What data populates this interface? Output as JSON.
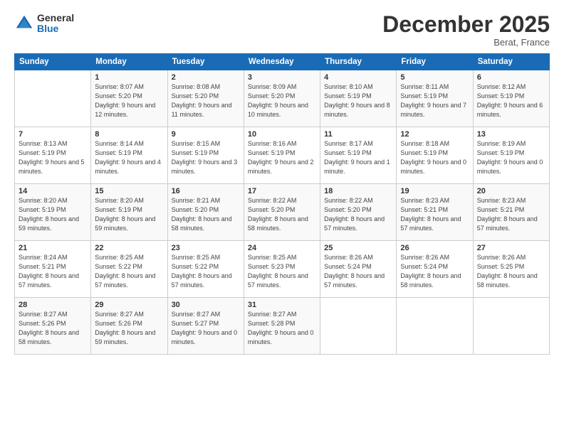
{
  "logo": {
    "general": "General",
    "blue": "Blue"
  },
  "header": {
    "title": "December 2025",
    "location": "Berat, France"
  },
  "days_of_week": [
    "Sunday",
    "Monday",
    "Tuesday",
    "Wednesday",
    "Thursday",
    "Friday",
    "Saturday"
  ],
  "weeks": [
    [
      {
        "day": "",
        "info": ""
      },
      {
        "day": "1",
        "info": "Sunrise: 8:07 AM\nSunset: 5:20 PM\nDaylight: 9 hours\nand 12 minutes."
      },
      {
        "day": "2",
        "info": "Sunrise: 8:08 AM\nSunset: 5:20 PM\nDaylight: 9 hours\nand 11 minutes."
      },
      {
        "day": "3",
        "info": "Sunrise: 8:09 AM\nSunset: 5:20 PM\nDaylight: 9 hours\nand 10 minutes."
      },
      {
        "day": "4",
        "info": "Sunrise: 8:10 AM\nSunset: 5:19 PM\nDaylight: 9 hours\nand 8 minutes."
      },
      {
        "day": "5",
        "info": "Sunrise: 8:11 AM\nSunset: 5:19 PM\nDaylight: 9 hours\nand 7 minutes."
      },
      {
        "day": "6",
        "info": "Sunrise: 8:12 AM\nSunset: 5:19 PM\nDaylight: 9 hours\nand 6 minutes."
      }
    ],
    [
      {
        "day": "7",
        "info": "Sunrise: 8:13 AM\nSunset: 5:19 PM\nDaylight: 9 hours\nand 5 minutes."
      },
      {
        "day": "8",
        "info": "Sunrise: 8:14 AM\nSunset: 5:19 PM\nDaylight: 9 hours\nand 4 minutes."
      },
      {
        "day": "9",
        "info": "Sunrise: 8:15 AM\nSunset: 5:19 PM\nDaylight: 9 hours\nand 3 minutes."
      },
      {
        "day": "10",
        "info": "Sunrise: 8:16 AM\nSunset: 5:19 PM\nDaylight: 9 hours\nand 2 minutes."
      },
      {
        "day": "11",
        "info": "Sunrise: 8:17 AM\nSunset: 5:19 PM\nDaylight: 9 hours\nand 1 minute."
      },
      {
        "day": "12",
        "info": "Sunrise: 8:18 AM\nSunset: 5:19 PM\nDaylight: 9 hours\nand 0 minutes."
      },
      {
        "day": "13",
        "info": "Sunrise: 8:19 AM\nSunset: 5:19 PM\nDaylight: 9 hours\nand 0 minutes."
      }
    ],
    [
      {
        "day": "14",
        "info": "Sunrise: 8:20 AM\nSunset: 5:19 PM\nDaylight: 8 hours\nand 59 minutes."
      },
      {
        "day": "15",
        "info": "Sunrise: 8:20 AM\nSunset: 5:19 PM\nDaylight: 8 hours\nand 59 minutes."
      },
      {
        "day": "16",
        "info": "Sunrise: 8:21 AM\nSunset: 5:20 PM\nDaylight: 8 hours\nand 58 minutes."
      },
      {
        "day": "17",
        "info": "Sunrise: 8:22 AM\nSunset: 5:20 PM\nDaylight: 8 hours\nand 58 minutes."
      },
      {
        "day": "18",
        "info": "Sunrise: 8:22 AM\nSunset: 5:20 PM\nDaylight: 8 hours\nand 57 minutes."
      },
      {
        "day": "19",
        "info": "Sunrise: 8:23 AM\nSunset: 5:21 PM\nDaylight: 8 hours\nand 57 minutes."
      },
      {
        "day": "20",
        "info": "Sunrise: 8:23 AM\nSunset: 5:21 PM\nDaylight: 8 hours\nand 57 minutes."
      }
    ],
    [
      {
        "day": "21",
        "info": "Sunrise: 8:24 AM\nSunset: 5:21 PM\nDaylight: 8 hours\nand 57 minutes."
      },
      {
        "day": "22",
        "info": "Sunrise: 8:25 AM\nSunset: 5:22 PM\nDaylight: 8 hours\nand 57 minutes."
      },
      {
        "day": "23",
        "info": "Sunrise: 8:25 AM\nSunset: 5:22 PM\nDaylight: 8 hours\nand 57 minutes."
      },
      {
        "day": "24",
        "info": "Sunrise: 8:25 AM\nSunset: 5:23 PM\nDaylight: 8 hours\nand 57 minutes."
      },
      {
        "day": "25",
        "info": "Sunrise: 8:26 AM\nSunset: 5:24 PM\nDaylight: 8 hours\nand 57 minutes."
      },
      {
        "day": "26",
        "info": "Sunrise: 8:26 AM\nSunset: 5:24 PM\nDaylight: 8 hours\nand 58 minutes."
      },
      {
        "day": "27",
        "info": "Sunrise: 8:26 AM\nSunset: 5:25 PM\nDaylight: 8 hours\nand 58 minutes."
      }
    ],
    [
      {
        "day": "28",
        "info": "Sunrise: 8:27 AM\nSunset: 5:26 PM\nDaylight: 8 hours\nand 58 minutes."
      },
      {
        "day": "29",
        "info": "Sunrise: 8:27 AM\nSunset: 5:26 PM\nDaylight: 8 hours\nand 59 minutes."
      },
      {
        "day": "30",
        "info": "Sunrise: 8:27 AM\nSunset: 5:27 PM\nDaylight: 9 hours\nand 0 minutes."
      },
      {
        "day": "31",
        "info": "Sunrise: 8:27 AM\nSunset: 5:28 PM\nDaylight: 9 hours\nand 0 minutes."
      },
      {
        "day": "",
        "info": ""
      },
      {
        "day": "",
        "info": ""
      },
      {
        "day": "",
        "info": ""
      }
    ]
  ]
}
